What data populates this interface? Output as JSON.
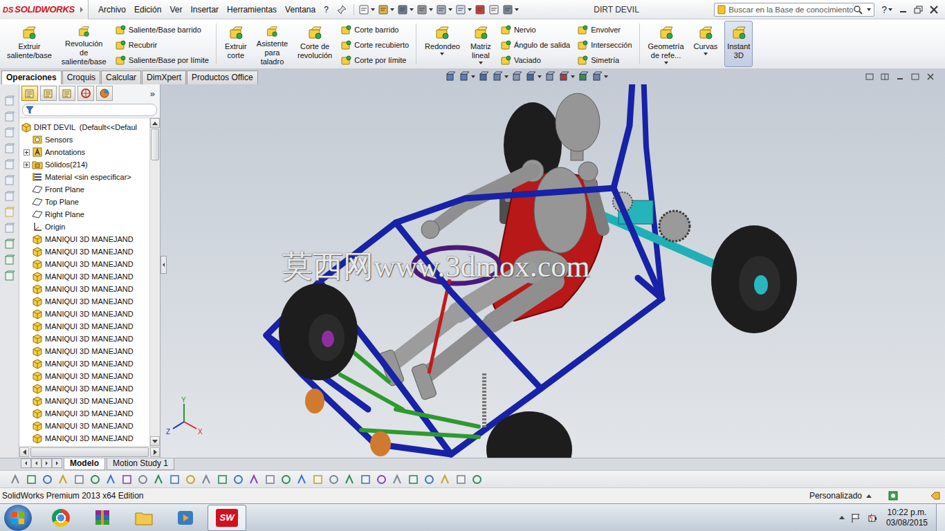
{
  "app": {
    "logo_mark": "DS",
    "logo": "SOLIDWORKS"
  },
  "menu": [
    "Archivo",
    "Edición",
    "Ver",
    "Insertar",
    "Herramientas",
    "Ventana",
    "?"
  ],
  "window": {
    "title": "DIRT DEVIL"
  },
  "search": {
    "placeholder": "Buscar en la Base de conocimiento"
  },
  "help": "?",
  "command_sections": [
    [
      {
        "kind": "big",
        "lines": [
          "Extruir",
          "saliente/base"
        ],
        "dropdown": false,
        "selected": false
      },
      {
        "kind": "big",
        "lines": [
          "Revolución",
          "de",
          "saliente/base"
        ],
        "dropdown": false,
        "selected": false
      },
      {
        "kind": "stack",
        "items": [
          "Saliente/Base barrido",
          "Recubrir",
          "Saliente/Base por límite"
        ]
      }
    ],
    [
      {
        "kind": "big",
        "lines": [
          "Extruir",
          "corte"
        ],
        "dropdown": false,
        "selected": false
      },
      {
        "kind": "big",
        "lines": [
          "Asistente",
          "para",
          "taladro"
        ],
        "dropdown": false,
        "selected": false
      },
      {
        "kind": "big",
        "lines": [
          "Corte de",
          "revolución"
        ],
        "dropdown": false,
        "selected": false
      },
      {
        "kind": "stack",
        "items": [
          "Corte barrido",
          "Corte recubierto",
          "Corte por límite"
        ]
      }
    ],
    [
      {
        "kind": "big",
        "lines": [
          "Redondeo"
        ],
        "dropdown": true,
        "selected": false
      },
      {
        "kind": "big",
        "lines": [
          "Matriz",
          "lineal"
        ],
        "dropdown": true,
        "selected": false
      },
      {
        "kind": "stack",
        "items": [
          "Nervio",
          "Ángulo de salida",
          "Vaciado"
        ]
      },
      {
        "kind": "stack",
        "items": [
          "Envolver",
          "Intersección",
          "Simetría"
        ]
      }
    ],
    [
      {
        "kind": "big",
        "lines": [
          "Geometría",
          "de refe..."
        ],
        "dropdown": true,
        "selected": false
      },
      {
        "kind": "big",
        "lines": [
          "Curvas"
        ],
        "dropdown": true,
        "selected": false
      },
      {
        "kind": "big",
        "lines": [
          "Instant",
          "3D"
        ],
        "dropdown": false,
        "selected": true
      }
    ]
  ],
  "tabs": [
    {
      "label": "Operaciones",
      "selected": true
    },
    {
      "label": "Croquis",
      "selected": false
    },
    {
      "label": "Calcular",
      "selected": false
    },
    {
      "label": "DimXpert",
      "selected": false
    },
    {
      "label": "Productos Office",
      "selected": false
    }
  ],
  "panel": {
    "more": "»",
    "tabs": [
      {
        "kind": "feature-manager",
        "selected": true
      },
      {
        "kind": "property-manager",
        "selected": false
      },
      {
        "kind": "configuration-manager",
        "selected": false
      },
      {
        "kind": "dimxpert-manager",
        "selected": false
      },
      {
        "kind": "display-manager",
        "selected": false
      }
    ]
  },
  "tree": [
    {
      "label": "DIRT DEVIL  (Default<<Defaul",
      "kind": "root",
      "expandable": false,
      "expanded": false
    },
    {
      "label": "Sensors",
      "kind": "sensors",
      "expandable": false,
      "expanded": false
    },
    {
      "label": "Annotations",
      "kind": "annotations",
      "expandable": true,
      "expanded": false
    },
    {
      "label": "Sólidos(214)",
      "kind": "folder",
      "expandable": true,
      "expanded": false
    },
    {
      "label": "Material <sin especificar>",
      "kind": "material",
      "expandable": false,
      "expanded": false
    },
    {
      "label": "Front Plane",
      "kind": "plane",
      "expandable": false,
      "expanded": false
    },
    {
      "label": "Top Plane",
      "kind": "plane",
      "expandable": false,
      "expanded": false
    },
    {
      "label": "Right Plane",
      "kind": "plane",
      "expandable": false,
      "expanded": false
    },
    {
      "label": "Origin",
      "kind": "origin",
      "expandable": false,
      "expanded": false
    },
    {
      "label": "MANIQUI 3D MANEJAND",
      "kind": "component",
      "expandable": false,
      "expanded": false
    },
    {
      "label": "MANIQUI 3D MANEJAND",
      "kind": "component",
      "expandable": false,
      "expanded": false
    },
    {
      "label": "MANIQUI 3D MANEJAND",
      "kind": "component",
      "expandable": false,
      "expanded": false
    },
    {
      "label": "MANIQUI 3D MANEJAND",
      "kind": "component",
      "expandable": false,
      "expanded": false
    },
    {
      "label": "MANIQUI 3D MANEJAND",
      "kind": "component",
      "expandable": false,
      "expanded": false
    },
    {
      "label": "MANIQUI 3D MANEJAND",
      "kind": "component",
      "expandable": false,
      "expanded": false
    },
    {
      "label": "MANIQUI 3D MANEJAND",
      "kind": "component",
      "expandable": false,
      "expanded": false
    },
    {
      "label": "MANIQUI 3D MANEJAND",
      "kind": "component",
      "expandable": false,
      "expanded": false
    },
    {
      "label": "MANIQUI 3D MANEJAND",
      "kind": "component",
      "expandable": false,
      "expanded": false
    },
    {
      "label": "MANIQUI 3D MANEJAND",
      "kind": "component",
      "expandable": false,
      "expanded": false
    },
    {
      "label": "MANIQUI 3D MANEJAND",
      "kind": "component",
      "expandable": false,
      "expanded": false
    },
    {
      "label": "MANIQUI 3D MANEJAND",
      "kind": "component",
      "expandable": false,
      "expanded": false
    },
    {
      "label": "MANIQUI 3D MANEJAND",
      "kind": "component",
      "expandable": false,
      "expanded": false
    },
    {
      "label": "MANIQUI 3D MANEJAND",
      "kind": "component",
      "expandable": false,
      "expanded": false
    },
    {
      "label": "MANIQUI 3D MANEJAND",
      "kind": "component",
      "expandable": false,
      "expanded": false
    },
    {
      "label": "MANIQUI 3D MANEJAND",
      "kind": "component",
      "expandable": false,
      "expanded": false
    },
    {
      "label": "MANIQUI 3D MANEJAND",
      "kind": "component",
      "expandable": false,
      "expanded": false
    }
  ],
  "viewport": {
    "watermark": "莫西网www.3dmox.com",
    "triad": {
      "x": "X",
      "y": "Y",
      "z": "Z"
    }
  },
  "bottom_tabs": [
    {
      "label": "Modelo",
      "selected": true
    },
    {
      "label": "Motion Study 1",
      "selected": false
    }
  ],
  "status_bar": {
    "text": "SolidWorks Premium 2013 x64 Edition",
    "units": "Personalizado"
  },
  "taskbar": {
    "apps": [
      {
        "kind": "chrome",
        "active": false,
        "label": ""
      },
      {
        "kind": "winrar",
        "active": false,
        "label": ""
      },
      {
        "kind": "explorer",
        "active": false,
        "label": ""
      },
      {
        "kind": "media",
        "active": false,
        "label": ""
      },
      {
        "kind": "solidworks",
        "active": true,
        "label": "SW"
      }
    ],
    "time": "10:22 p.m.",
    "date": "03/08/2015"
  }
}
